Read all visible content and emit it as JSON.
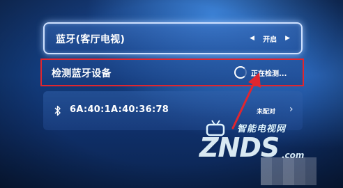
{
  "bluetooth_row": {
    "label": "蓝牙(客厅电视)",
    "value": "开启",
    "left_arrow_icon": "triangle-left-icon",
    "right_arrow_icon": "triangle-right-icon"
  },
  "scan_row": {
    "label": "检测蓝牙设备",
    "status": "正在检测..."
  },
  "device_row": {
    "icon": "bluetooth-icon",
    "address": "6A:40:1A:40:36:78",
    "status": "未配对",
    "chevron_icon": "chevron-right-icon"
  },
  "watermark": {
    "brand_cn": "智能电视网",
    "brand": "ZNDS",
    "domain": ".com"
  },
  "colors": {
    "annotation_red": "#e0262f",
    "focus_border": "#cfe1ff",
    "background": "#123b7b"
  }
}
